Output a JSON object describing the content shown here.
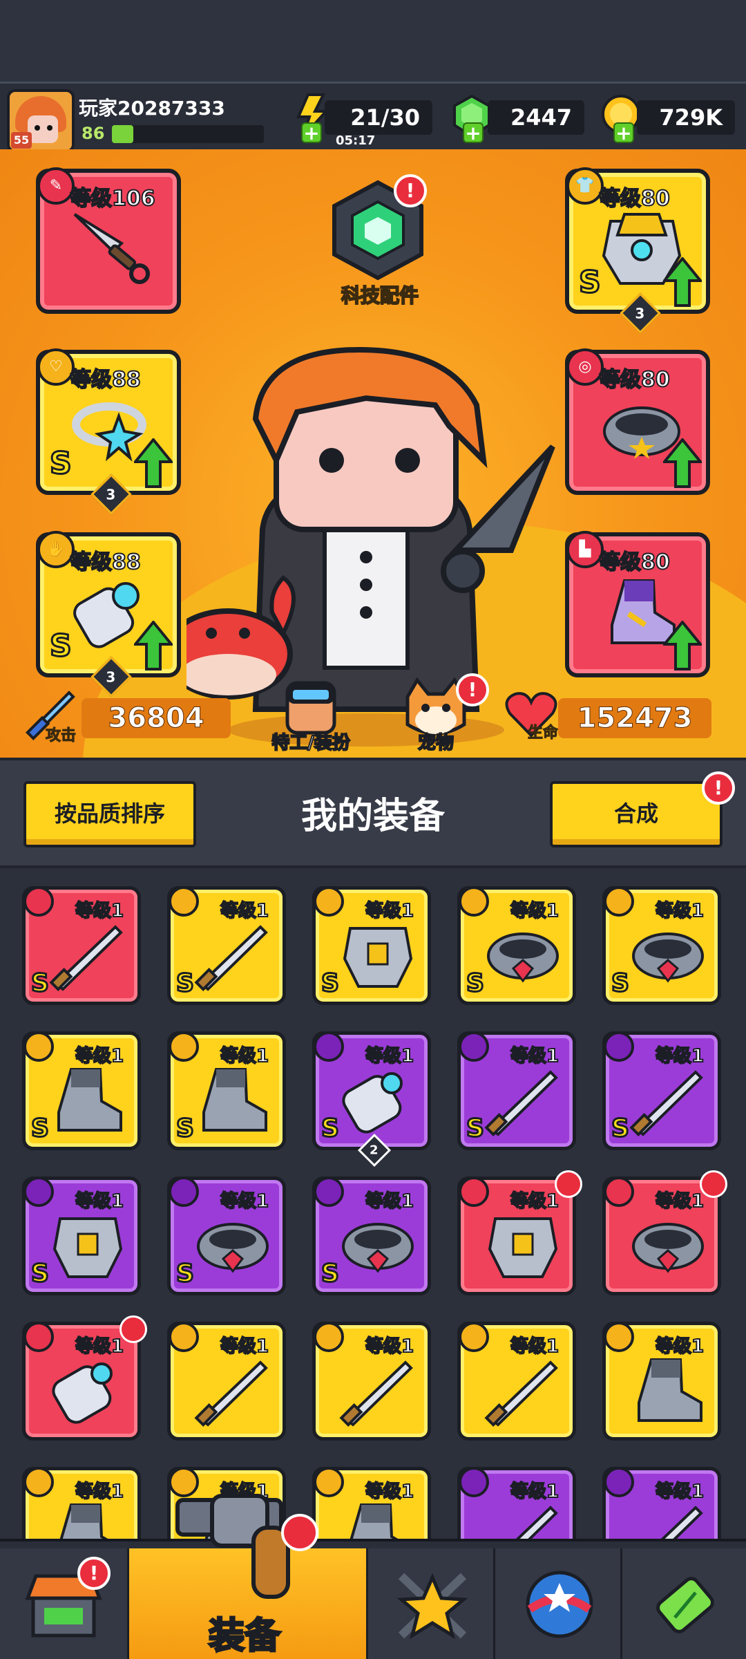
{
  "player": {
    "name": "玩家20287333",
    "level": "86",
    "avatar_badge": "55",
    "xp_fraction": 0.14
  },
  "resources": {
    "energy": "21/30",
    "energy_timer": "05:17",
    "gems": "2447",
    "coins": "729K"
  },
  "hero": {
    "tech_parts_label": "科技配件",
    "slots": {
      "weapon": {
        "level_label": "等级106",
        "icon": "weapon-icon"
      },
      "necklace": {
        "level_label": "等级88",
        "grade": "S",
        "count": "3",
        "icon": "necklace-icon"
      },
      "glove": {
        "level_label": "等级88",
        "grade": "S",
        "count": "3",
        "icon": "glove-icon"
      },
      "armor": {
        "level_label": "等级80",
        "grade": "S",
        "count": "3",
        "icon": "armor-icon"
      },
      "belt": {
        "level_label": "等级80",
        "icon": "belt-icon"
      },
      "boots": {
        "level_label": "等级80",
        "icon": "boots-icon"
      }
    },
    "attack_label": "攻击",
    "attack_value": "36804",
    "agent_label": "特工/装扮",
    "pet_label": "宠物",
    "hp_label": "生命",
    "hp_value": "152473"
  },
  "equipment": {
    "sort_button": "按品质排序",
    "title": "我的装备",
    "merge_button": "合成",
    "items": [
      {
        "level": "等级1",
        "rarity": "red",
        "grade": "S",
        "icon": "sword-icon",
        "type": "weapon"
      },
      {
        "level": "等级1",
        "rarity": "yellow",
        "grade": "S",
        "icon": "blaster-icon",
        "type": "weapon"
      },
      {
        "level": "等级1",
        "rarity": "yellow",
        "grade": "S",
        "icon": "mech-armor-icon",
        "type": "armor"
      },
      {
        "level": "等级1",
        "rarity": "yellow",
        "grade": "S",
        "icon": "hex-belt-icon",
        "type": "belt"
      },
      {
        "level": "等级1",
        "rarity": "yellow",
        "grade": "S",
        "icon": "gem-belt-icon",
        "type": "belt"
      },
      {
        "level": "等级1",
        "rarity": "yellow",
        "grade": "S",
        "icon": "spiked-boots-icon",
        "type": "boots"
      },
      {
        "level": "等级1",
        "rarity": "yellow",
        "grade": "S",
        "icon": "spiked-boots-icon",
        "type": "boots"
      },
      {
        "level": "等级1",
        "rarity": "purple",
        "grade": "S",
        "icon": "power-glove-icon",
        "type": "glove",
        "count": "2"
      },
      {
        "level": "等级1",
        "rarity": "purple",
        "grade": "S",
        "icon": "blaster-icon",
        "type": "weapon"
      },
      {
        "level": "等级1",
        "rarity": "purple",
        "grade": "S",
        "icon": "blaster-icon",
        "type": "weapon"
      },
      {
        "level": "等级1",
        "rarity": "purple",
        "grade": "S",
        "icon": "dark-armor-icon",
        "type": "armor"
      },
      {
        "level": "等级1",
        "rarity": "purple",
        "grade": "S",
        "icon": "star-ring-icon",
        "type": "necklace"
      },
      {
        "level": "等级1",
        "rarity": "purple",
        "grade": "S",
        "icon": "gem-belt-icon",
        "type": "belt"
      },
      {
        "level": "等级1",
        "rarity": "red",
        "grade": "",
        "icon": "vest-icon",
        "type": "armor",
        "new": true
      },
      {
        "level": "等级1",
        "rarity": "red",
        "grade": "",
        "icon": "spiked-collar-icon",
        "type": "necklace",
        "new": true
      },
      {
        "level": "等级1",
        "rarity": "red",
        "grade": "",
        "icon": "gauntlet-icon",
        "type": "glove",
        "new": true
      },
      {
        "level": "等级1",
        "rarity": "yellow",
        "grade": "",
        "icon": "katana-icon",
        "type": "weapon"
      },
      {
        "level": "等级1",
        "rarity": "yellow",
        "grade": "",
        "icon": "katana-icon",
        "type": "weapon"
      },
      {
        "level": "等级1",
        "rarity": "yellow",
        "grade": "",
        "icon": "katana-icon",
        "type": "weapon"
      },
      {
        "level": "等级1",
        "rarity": "yellow",
        "grade": "",
        "icon": "boot-icon",
        "type": "boots"
      },
      {
        "level": "等级1",
        "rarity": "yellow",
        "grade": "",
        "icon": "boot-icon",
        "type": "boots"
      },
      {
        "level": "等级1",
        "rarity": "yellow",
        "grade": "",
        "icon": "boot-icon",
        "type": "boots"
      },
      {
        "level": "等级1",
        "rarity": "yellow",
        "grade": "",
        "icon": "boot-icon",
        "type": "boots"
      },
      {
        "level": "等级1",
        "rarity": "purple",
        "grade": "",
        "icon": "kunai-icon",
        "type": "weapon"
      },
      {
        "level": "等级1",
        "rarity": "purple",
        "grade": "",
        "icon": "blade-icon",
        "type": "weapon"
      }
    ]
  },
  "nav": {
    "tabs": [
      {
        "icon": "shop-icon",
        "label": ""
      },
      {
        "icon": "revolver-icon",
        "label": "装备"
      },
      {
        "icon": "battle-star-icon",
        "label": ""
      },
      {
        "icon": "talent-orb-icon",
        "label": ""
      },
      {
        "icon": "dna-capsule-icon",
        "label": ""
      }
    ],
    "active_index": 1
  },
  "colors": {
    "hero_bg": "#f6951a",
    "rarity_red": "#f0425a",
    "rarity_yellow": "#ffd21c",
    "rarity_purple": "#9b3cd8",
    "alert": "#e92d3d",
    "upgrade_green": "#3cc43a"
  }
}
